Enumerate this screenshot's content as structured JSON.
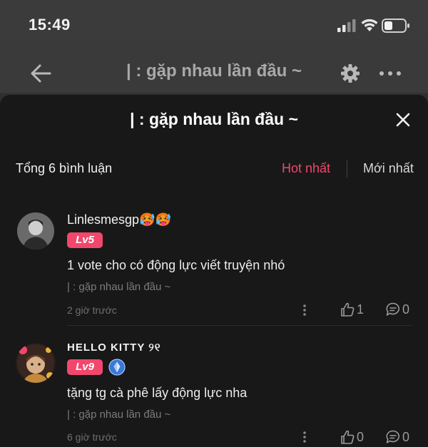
{
  "status": {
    "time": "15:49"
  },
  "topbar": {
    "title": "| : gặp nhau lần đầu ~"
  },
  "sheet": {
    "title": "| : gặp nhau lần đầu ~",
    "total_label": "Tổng 6 bình luận",
    "sort_hot": "Hot nhất",
    "sort_new": "Mới nhất"
  },
  "comments": [
    {
      "username": "Linlesmesgp🥵🥵",
      "level": "Lv5",
      "text": "1 vote cho có động lực viết truyện nhó",
      "chapter": "| : gặp nhau lần đầu ~",
      "time": "2 giờ trước",
      "likes": "1",
      "replies": "0"
    },
    {
      "username": "HELLO KITTY ୨୧",
      "level": "Lv9",
      "text": "tặng tg cà phê lấy động lực nha",
      "chapter": "| : gặp nhau lần đầu ~",
      "time": "6 giờ trước",
      "likes": "0",
      "replies": "0"
    }
  ],
  "colors": {
    "accent": "#f0476b",
    "level_badge": "#f2476c",
    "sheet_bg": "#181818"
  },
  "icons": [
    "back-arrow-icon",
    "gear-icon",
    "more-dots-icon",
    "close-icon",
    "kebab-icon",
    "thumbs-up-icon",
    "comment-bubble-icon",
    "diamond-badge-icon"
  ]
}
